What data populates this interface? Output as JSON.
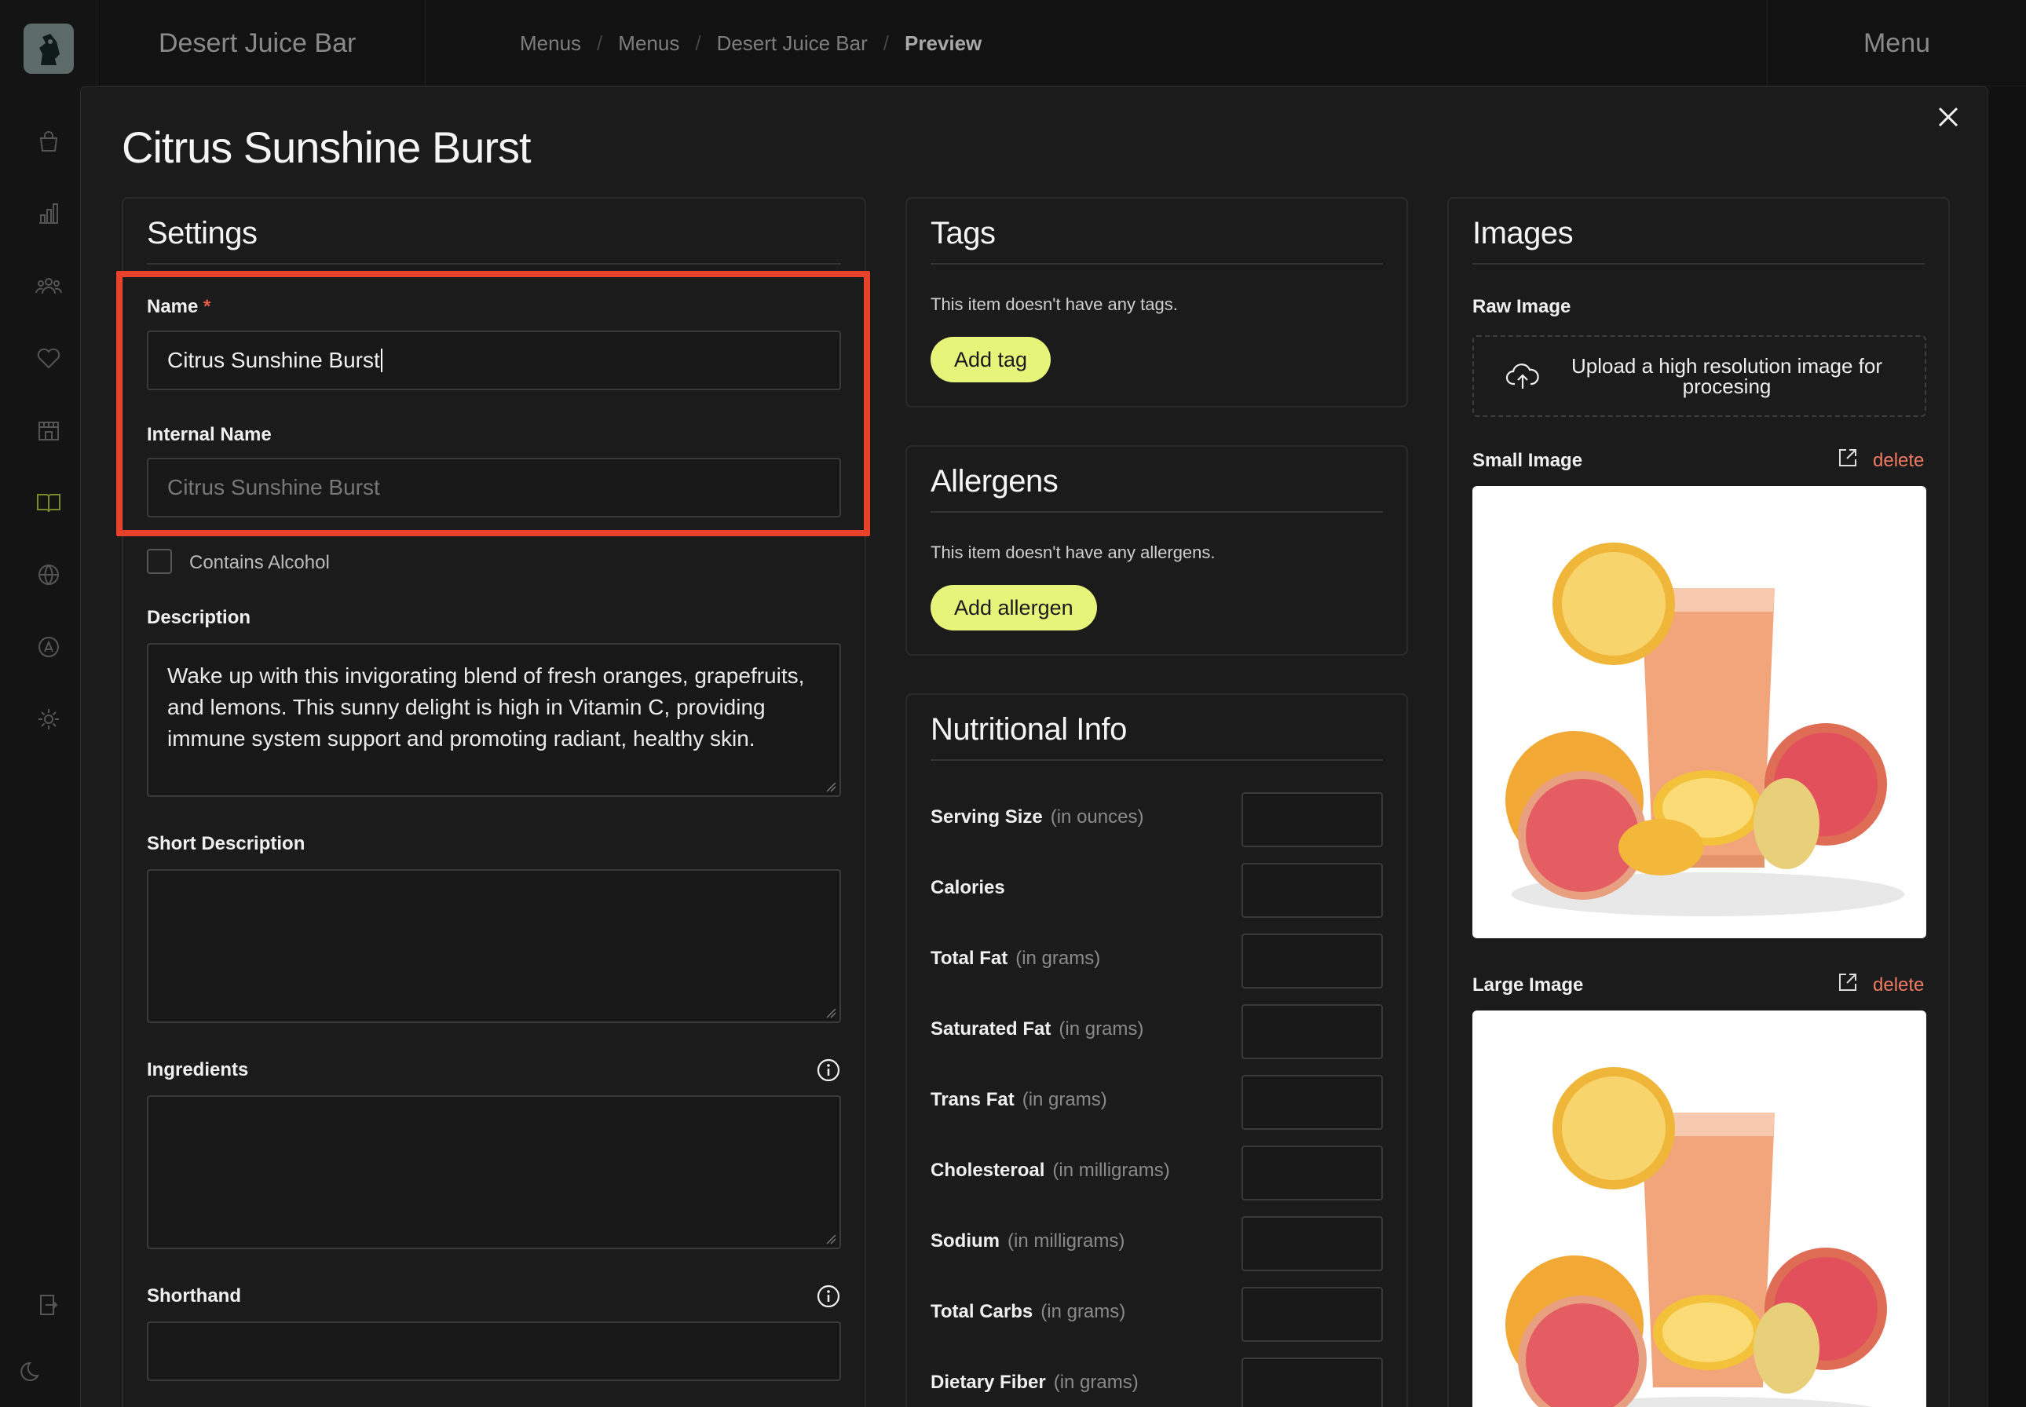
{
  "app": {
    "brand": "Desert Juice Bar",
    "menu_tab": "Menu"
  },
  "breadcrumbs": [
    "Menus",
    "Menus",
    "Desert Juice Bar",
    "Preview"
  ],
  "modal": {
    "title": "Citrus Sunshine Burst"
  },
  "settings": {
    "heading": "Settings",
    "name_label": "Name",
    "name_required": "*",
    "name_value": "Citrus Sunshine Burst",
    "internal_name_label": "Internal Name",
    "internal_name_placeholder": "Citrus Sunshine Burst",
    "contains_alcohol_label": "Contains Alcohol",
    "contains_alcohol_checked": false,
    "description_label": "Description",
    "description_value": "Wake up with this invigorating blend of fresh oranges, grapefruits, and lemons. This sunny delight is high in Vitamin C, providing immune system support and promoting radiant, healthy skin.",
    "short_description_label": "Short Description",
    "short_description_value": "",
    "ingredients_label": "Ingredients",
    "ingredients_value": "",
    "shorthand_label": "Shorthand",
    "shorthand_value": ""
  },
  "tags": {
    "heading": "Tags",
    "empty_text": "This item doesn't have any tags.",
    "add_label": "Add tag"
  },
  "allergens": {
    "heading": "Allergens",
    "empty_text": "This item doesn't have any allergens.",
    "add_label": "Add allergen"
  },
  "nutrition": {
    "heading": "Nutritional Info",
    "rows": [
      {
        "label": "Serving Size",
        "unit": "(in ounces)"
      },
      {
        "label": "Calories",
        "unit": ""
      },
      {
        "label": "Total Fat",
        "unit": "(in grams)"
      },
      {
        "label": "Saturated Fat",
        "unit": "(in grams)"
      },
      {
        "label": "Trans Fat",
        "unit": "(in grams)"
      },
      {
        "label": "Cholesteroal",
        "unit": "(in milligrams)"
      },
      {
        "label": "Sodium",
        "unit": "(in milligrams)"
      },
      {
        "label": "Total Carbs",
        "unit": "(in grams)"
      },
      {
        "label": "Dietary Fiber",
        "unit": "(in grams)"
      }
    ]
  },
  "images": {
    "heading": "Images",
    "raw_label": "Raw Image",
    "upload_text": "Upload a high resolution image for procesing",
    "small_label": "Small Image",
    "large_label": "Large Image",
    "delete_label": "delete"
  },
  "colors": {
    "accent": "#e6f57a",
    "highlight": "#e8412c",
    "delete": "#ef7b63"
  }
}
